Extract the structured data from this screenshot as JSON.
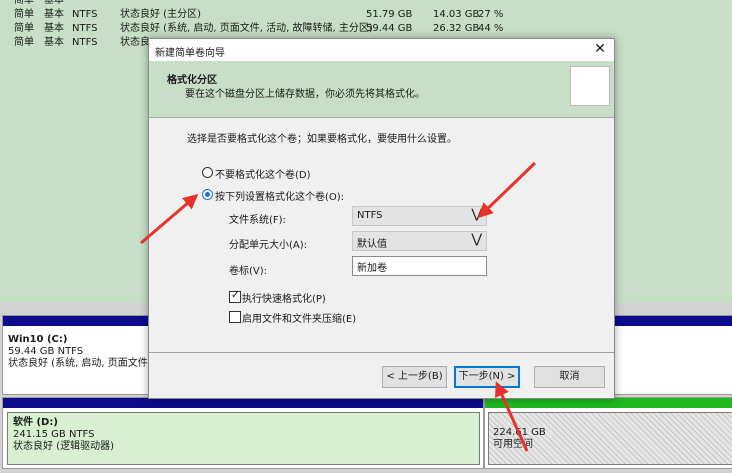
{
  "volume_list": {
    "rows": [
      {
        "layout": "简单",
        "type": "基本",
        "fs": "",
        "status": "",
        "capacity": "",
        "free": "",
        "pct": ""
      },
      {
        "layout": "简单",
        "type": "基本",
        "fs": "NTFS",
        "status": "状态良好 (主分区)",
        "capacity": "51.79 GB",
        "free": "14.03 GB",
        "pct": "27 %"
      },
      {
        "layout": "简单",
        "type": "基本",
        "fs": "NTFS",
        "status": "状态良好 (系统, 启动, 页面文件, 活动, 故障转储, 主分区)",
        "capacity": "59.44 GB",
        "free": "26.32 GB",
        "pct": "44 %"
      },
      {
        "layout": "简单",
        "type": "基本",
        "fs": "NTFS",
        "status": "状态良",
        "capacity": "",
        "free": "",
        "pct": ""
      }
    ]
  },
  "disk_map": {
    "c": {
      "name": "Win10  (C:)",
      "size": "59.44 GB NTFS",
      "status": "状态良好 (系统, 启动, 页面文件, 活"
    },
    "d": {
      "name": "软件  (D:)",
      "size": "241.15 GB NTFS",
      "status": "状态良好 (逻辑驱动器)"
    },
    "free": {
      "size": "224.61 GB",
      "status": "可用空间"
    }
  },
  "dialog": {
    "title": "新建简单卷向导",
    "header_title": "格式化分区",
    "header_desc": "要在这个磁盘分区上储存数据，你必须先将其格式化。",
    "prompt": "选择是否要格式化这个卷；如果要格式化，要使用什么设置。",
    "opt_no_format": "不要格式化这个卷(D)",
    "opt_format": "按下列设置格式化这个卷(O):",
    "fs_label": "文件系统(F):",
    "fs_value": "NTFS",
    "alloc_label": "分配单元大小(A):",
    "alloc_value": "默认值",
    "vol_label": "卷标(V):",
    "vol_value": "新加卷",
    "quick_format": "执行快速格式化(P)",
    "compression": "启用文件和文件夹压缩(E)",
    "back_btn": "< 上一步(B)",
    "next_btn": "下一步(N) >",
    "cancel_btn": "取消",
    "close_glyph": "✕"
  },
  "icons": {
    "combo_arrow": "⋁",
    "check_mark": "✓"
  },
  "colors": {
    "accent": "#1a6fe0",
    "annotation_arrow": "#e8312a",
    "header_bg": "#c6dfc6",
    "free_bar": "#1fb81f",
    "primary_bar": "#0b0b8c"
  }
}
